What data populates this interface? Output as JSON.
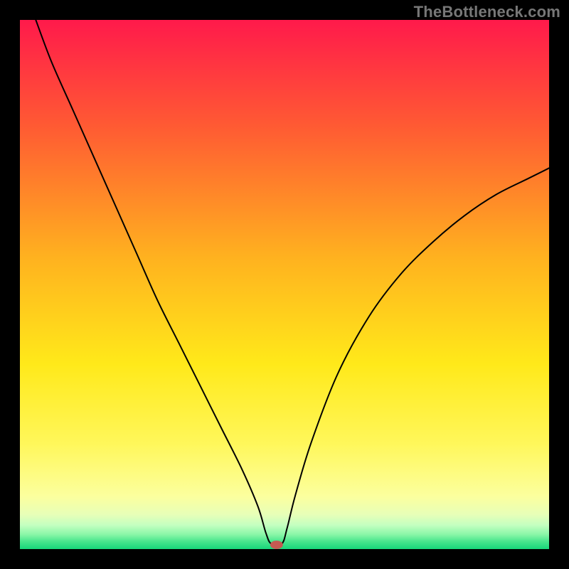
{
  "watermark": "TheBottleneck.com",
  "chart_data": {
    "type": "line",
    "title": "",
    "xlabel": "",
    "ylabel": "",
    "xlim": [
      0,
      100
    ],
    "ylim": [
      0,
      100
    ],
    "gradient_stops": [
      {
        "offset": 0.0,
        "color": "#ff1a4b"
      },
      {
        "offset": 0.2,
        "color": "#ff5a33"
      },
      {
        "offset": 0.45,
        "color": "#ffb21f"
      },
      {
        "offset": 0.65,
        "color": "#ffe91a"
      },
      {
        "offset": 0.8,
        "color": "#fff75a"
      },
      {
        "offset": 0.9,
        "color": "#fcff9e"
      },
      {
        "offset": 0.935,
        "color": "#e7ffb8"
      },
      {
        "offset": 0.955,
        "color": "#c3ffc0"
      },
      {
        "offset": 0.972,
        "color": "#8bf7a8"
      },
      {
        "offset": 0.985,
        "color": "#4be68e"
      },
      {
        "offset": 1.0,
        "color": "#17d67a"
      }
    ],
    "series": [
      {
        "name": "bottleneck-curve",
        "x": [
          3,
          6,
          10,
          14,
          18,
          22,
          26,
          30,
          34,
          38,
          42,
          45,
          46.5,
          47.5,
          49.5,
          50.5,
          52,
          55,
          60,
          66,
          72,
          78,
          84,
          90,
          96,
          100
        ],
        "y": [
          100,
          92,
          83,
          74,
          65,
          56,
          47,
          39,
          31,
          23,
          15,
          8,
          3,
          1,
          1,
          4,
          10,
          20,
          33,
          44,
          52,
          58,
          63,
          67,
          70,
          72
        ]
      }
    ],
    "marker": {
      "x": 48.5,
      "y": 0.8,
      "rx": 1.2,
      "ry": 0.8,
      "color": "#c65a52"
    },
    "legend": []
  }
}
